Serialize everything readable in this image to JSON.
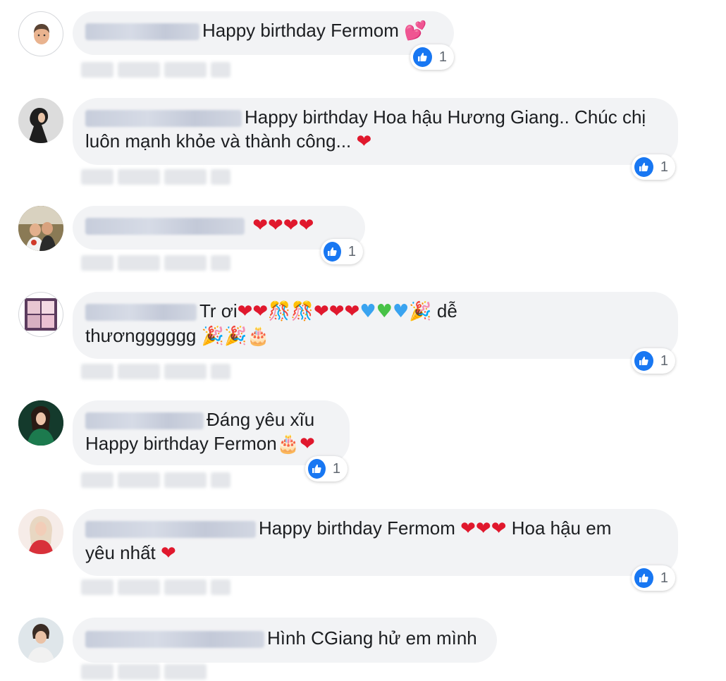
{
  "comments": [
    {
      "text": "Happy birthday Fermom",
      "emoji": "💕",
      "reactions": {
        "count": "1"
      }
    },
    {
      "text_line1": "Happy birthday Hoa hậu Hương Giang.. Chúc chị",
      "text_line2": "luôn mạnh khỏe và thành công...",
      "emoji": "❤",
      "reactions": {
        "count": "1"
      }
    },
    {
      "emoji": "❤❤❤❤",
      "reactions": {
        "count": "1"
      }
    },
    {
      "text_prefix": "Tr ơi",
      "text_mid": "dễ",
      "text_line2": "thươngggggg",
      "reactions": {
        "count": "1"
      }
    },
    {
      "text_line1": "Đáng yêu xĩu",
      "text_line2": "Happy birthday Fermon",
      "reactions": {
        "count": "1"
      }
    },
    {
      "text_part1": "Happy birthday Fermom",
      "text_part2": "Hoa hậu em",
      "text_line2": "yêu nhất",
      "reactions": {
        "count": "1"
      }
    },
    {
      "text": "Hình CGiang hử em mình"
    }
  ],
  "icons": {
    "like": "like-thumb-icon",
    "heart": "heart-emoji-icon",
    "confetti": "confetti-emoji-icon",
    "party": "party-popper-emoji-icon",
    "cake": "birthday-cake-emoji-icon"
  },
  "colors": {
    "bubble": "#f2f3f5",
    "like_blue": "#1877f2",
    "heart_red": "#e0182d"
  }
}
